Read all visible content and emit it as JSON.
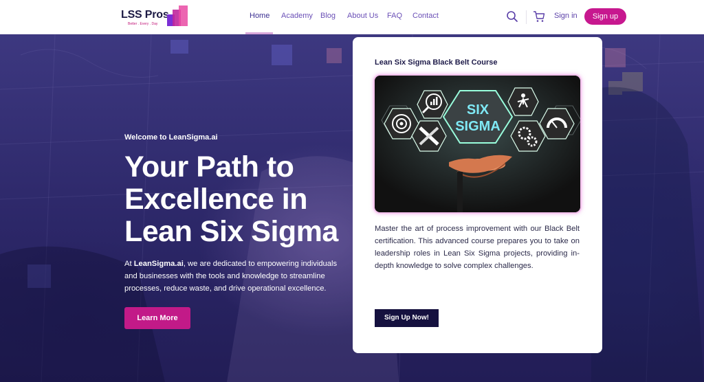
{
  "header": {
    "logo": {
      "text": "LSS Pros",
      "tagline": "Better . Every . Day",
      "mark_colors": [
        "#7b2fd6",
        "#c0269c",
        "#e94aa3"
      ]
    },
    "nav": [
      {
        "label": "Home",
        "active": true
      },
      {
        "label": "Academy"
      },
      {
        "label": "Blog"
      },
      {
        "label": "About Us"
      },
      {
        "label": "FAQ"
      },
      {
        "label": "Contact"
      }
    ],
    "icons": {
      "search": "search-icon",
      "cart": "cart-icon"
    },
    "signin_label": "Sign in",
    "signup_label": "Sign up"
  },
  "hero": {
    "welcome": "Welcome to LeanSigma.ai",
    "title": "Your Path to Excellence in Lean Six Sigma",
    "description_prefix": "At ",
    "description_brand": "LeanSigma.ai",
    "description_rest": ", we are dedicated to empowering individuals and businesses with the tools and knowledge to streamline processes, reduce waste, and drive operational excellence.",
    "cta_label": "Learn More"
  },
  "course_card": {
    "title": "Lean Six Sigma Black Belt Course",
    "image": {
      "line1": "SIX",
      "line2": "SIGMA",
      "icons": [
        "target-icon",
        "magnifier-chart-icon",
        "tools-icon",
        "growth-figure-icon",
        "gears-icon",
        "gauge-icon",
        "open-hand-icon"
      ]
    },
    "description": "Master the art of process improvement with our Black Belt certification. This advanced course prepares you to take on leadership roles in Lean Six Sigma projects, providing in-depth knowledge to solve complex challenges.",
    "cta_label": "Sign Up Now!"
  },
  "colors": {
    "accent": "#c7188f",
    "navy": "#15113f",
    "nav_text": "#6a4fb6",
    "hero_overlay": "#2c2768"
  }
}
